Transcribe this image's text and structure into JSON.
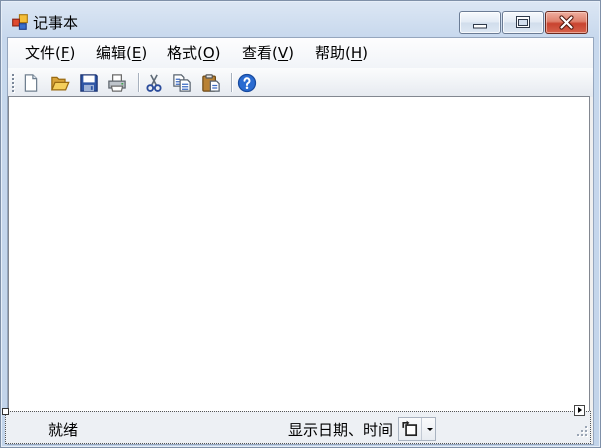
{
  "window": {
    "title": "记事本",
    "icon": "app-icon",
    "caption_buttons": [
      "minimize-icon",
      "maximize-icon",
      "close-icon"
    ]
  },
  "menu": {
    "items": [
      {
        "label": "文件(F)"
      },
      {
        "label": "编辑(E)"
      },
      {
        "label": "格式(O)"
      },
      {
        "label": "查看(V)"
      },
      {
        "label": "帮助(H)"
      }
    ]
  },
  "toolbar": {
    "groups": [
      [
        "new-document-icon",
        "open-folder-icon",
        "save-icon",
        "print-icon"
      ],
      [
        "cut-icon",
        "copy-icon",
        "paste-icon"
      ],
      [
        "help-icon"
      ]
    ]
  },
  "status_bar": {
    "status": "就绪",
    "datetime_label": "显示日期、时间",
    "datetime_button": {
      "icon": "clock-rotate-icon",
      "dropdown": "chevron-down-icon"
    }
  },
  "colors": {
    "title_bar": "#C7D8ED",
    "close_button": "#C8432F",
    "menu_background": "#F1F4F8",
    "editor_background": "#FFFFFF",
    "status_background": "#EDF0F4"
  }
}
